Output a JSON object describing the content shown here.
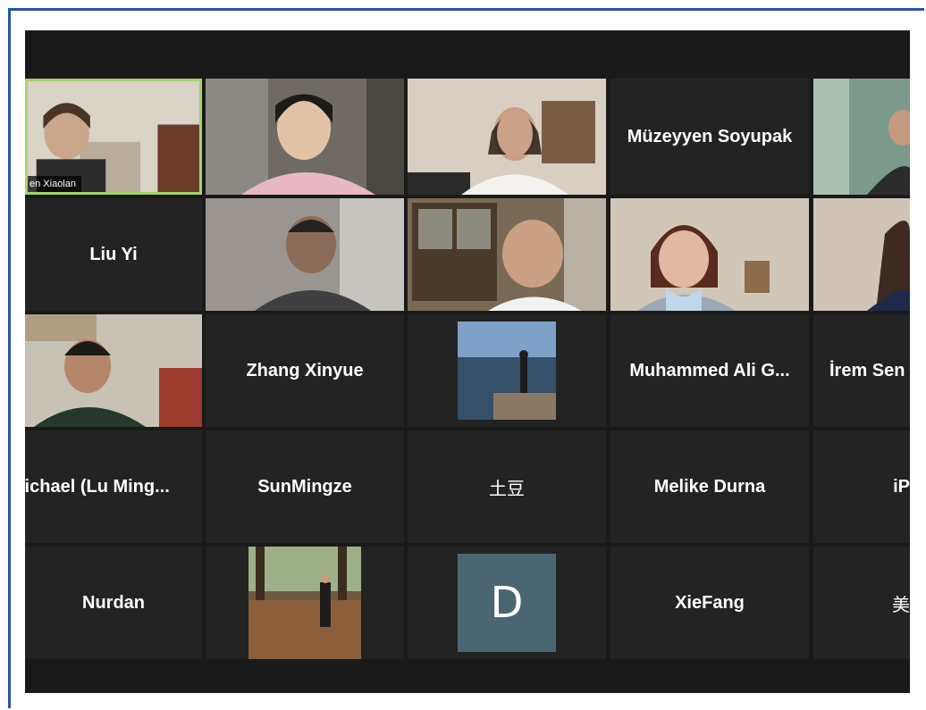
{
  "participants": {
    "chen": {
      "label": "en Xiaolan"
    },
    "liu": {
      "name": "Liu Yi"
    },
    "muzeyyen": {
      "name": "Müzeyyen Soyupak"
    },
    "zhang": {
      "name": "Zhang Xinyue"
    },
    "muhammed": {
      "name": "Muhammed Ali G..."
    },
    "irem": {
      "name": "İrem Sen"
    },
    "michael": {
      "name": "lichael (Lu Ming..."
    },
    "sun": {
      "name": "SunMingze"
    },
    "tudou": {
      "name": "土豆"
    },
    "melike": {
      "name": "Melike Durna"
    },
    "ip": {
      "name": "iP"
    },
    "nurdan": {
      "name": "Nurdan"
    },
    "d": {
      "initial": "D"
    },
    "xie": {
      "name": "XieFang"
    },
    "mei": {
      "name": "美"
    }
  },
  "colors": {
    "frame_border": "#2554a5",
    "active_speaker_border": "#a6d36a",
    "tile_background": "#232323",
    "avatar_background": "#4a6672"
  }
}
